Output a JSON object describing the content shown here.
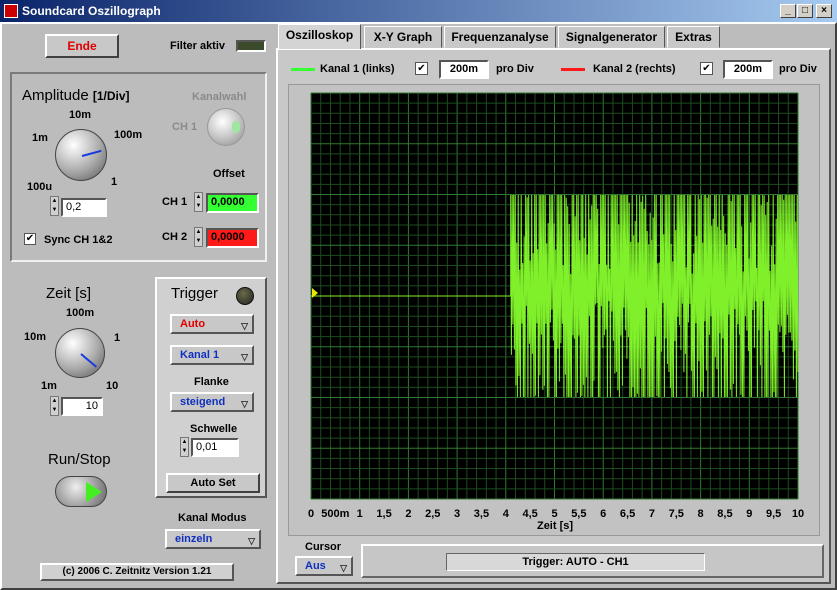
{
  "window": {
    "title": "Soundcard Oszillograph",
    "min_icon": "minimize-icon",
    "max_icon": "maximize-icon",
    "close_icon": "close-icon"
  },
  "left": {
    "ende_label": "Ende",
    "filter_label": "Filter aktiv",
    "amplitude": {
      "title": "Amplitude",
      "unit": "[1/Div]",
      "ticks": [
        "10m",
        "1m",
        "100m",
        "100u",
        "1"
      ],
      "value": "0,2",
      "sync_label": "Sync CH 1&2",
      "sync_checked": true
    },
    "kanalwahl": {
      "label": "Kanalwahl",
      "ch_label": "CH 1"
    },
    "offset": {
      "label": "Offset",
      "ch1_label": "CH 1",
      "ch1_value": "0,0000",
      "ch1_color": "#33ff33",
      "ch2_label": "CH 2",
      "ch2_value": "0,0000",
      "ch2_color": "#ff1a1a"
    },
    "zeit": {
      "title": "Zeit [s]",
      "ticks": [
        "100m",
        "10m",
        "1",
        "1m",
        "10"
      ],
      "value": "10"
    },
    "trigger": {
      "title": "Trigger",
      "mode": "Auto",
      "channel": "Kanal 1",
      "flanke_label": "Flanke",
      "flanke": "steigend",
      "schwelle_label": "Schwelle",
      "schwelle": "0,01",
      "autoset_label": "Auto Set"
    },
    "runstop_label": "Run/Stop",
    "kanal_modus": {
      "label": "Kanal Modus",
      "value": "einzeln"
    },
    "copyright": "(c) 2006 C. Zeitnitz Version 1.21"
  },
  "tabs": [
    "Oszilloskop",
    "X-Y Graph",
    "Frequenzanalyse",
    "Signalgenerator",
    "Extras"
  ],
  "legend": {
    "ch1_label": "Kanal 1 (links)",
    "ch1_color": "#33ff33",
    "ch1_checked": true,
    "ch1_div": "200m",
    "ch2_label": "Kanal 2 (rechts)",
    "ch2_color": "#ff1a1a",
    "ch2_checked": true,
    "ch2_div": "200m",
    "pro_div": "pro Div"
  },
  "chart_data": {
    "type": "line",
    "xlabel": "Zeit [s]",
    "x_ticks": [
      "0",
      "500m",
      "1",
      "1,5",
      "2",
      "2,5",
      "3",
      "3,5",
      "4",
      "4,5",
      "5",
      "5,5",
      "6",
      "6,5",
      "7",
      "7,5",
      "8",
      "8,5",
      "9",
      "9,5",
      "10"
    ],
    "xlim": [
      0,
      10
    ],
    "grid": true,
    "series": [
      {
        "name": "Kanal 1 (links)",
        "color": "#7ff02a",
        "quiet_until": 4.1,
        "baseline": 0,
        "burst_high": 1.0,
        "burst_low": -1.0
      }
    ]
  },
  "bottom": {
    "cursor_label": "Cursor",
    "cursor_value": "Aus",
    "status": "Trigger: AUTO - CH1"
  }
}
